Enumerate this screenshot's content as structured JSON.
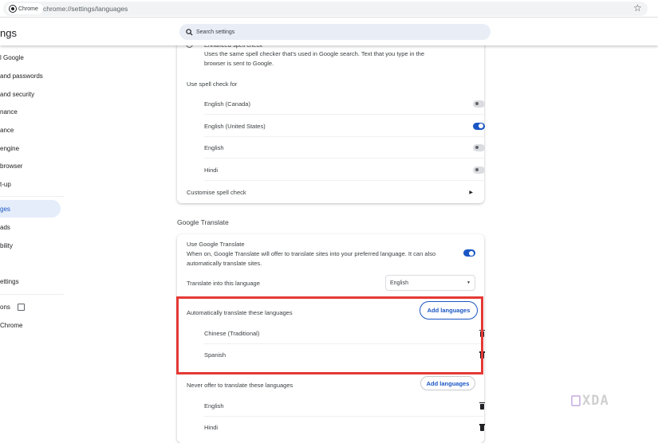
{
  "browser": {
    "chip": "Chrome",
    "url": "chrome://settings/languages"
  },
  "header": {
    "title": "ngs",
    "search_placeholder": "Search settings"
  },
  "sidebar": {
    "items": [
      {
        "label": "l Google"
      },
      {
        "label": "and passwords"
      },
      {
        "label": "and security"
      },
      {
        "label": "nance"
      },
      {
        "label": "ance"
      },
      {
        "label": "engine"
      },
      {
        "label": "browser"
      },
      {
        "label": "t-up"
      },
      {
        "label": "ges",
        "selected": true
      },
      {
        "label": "ads"
      },
      {
        "label": "bility"
      },
      {
        "label": "ettings"
      },
      {
        "label": "ons"
      },
      {
        "label": "Chrome"
      }
    ]
  },
  "spellcheck": {
    "enhanced_title": "Enhanced spell check",
    "enhanced_desc": "Uses the same spell checker that's used in Google search. Text that you type in the browser is sent to Google.",
    "use_for_label": "Use spell check for",
    "languages": [
      {
        "name": "English (Canada)",
        "on": false
      },
      {
        "name": "English (United States)",
        "on": true
      },
      {
        "name": "English",
        "on": false
      },
      {
        "name": "Hindi",
        "on": false
      }
    ],
    "customise_label": "Customise spell check"
  },
  "translate": {
    "heading": "Google Translate",
    "use_title": "Use Google Translate",
    "use_desc": "When on, Google Translate will offer to translate sites into your preferred language. It can also automatically translate sites.",
    "use_on": true,
    "into_label": "Translate into this language",
    "into_value": "English",
    "auto_label": "Automatically translate these languages",
    "auto_add": "Add languages",
    "auto_languages": [
      "Chinese (Traditional)",
      "Spanish"
    ],
    "never_label": "Never offer to translate these languages",
    "never_add": "Add languages",
    "never_languages": [
      "English",
      "Hindi"
    ]
  },
  "colors": {
    "accent": "#1a56c4",
    "highlight": "#e53935"
  },
  "watermark": "XDA"
}
